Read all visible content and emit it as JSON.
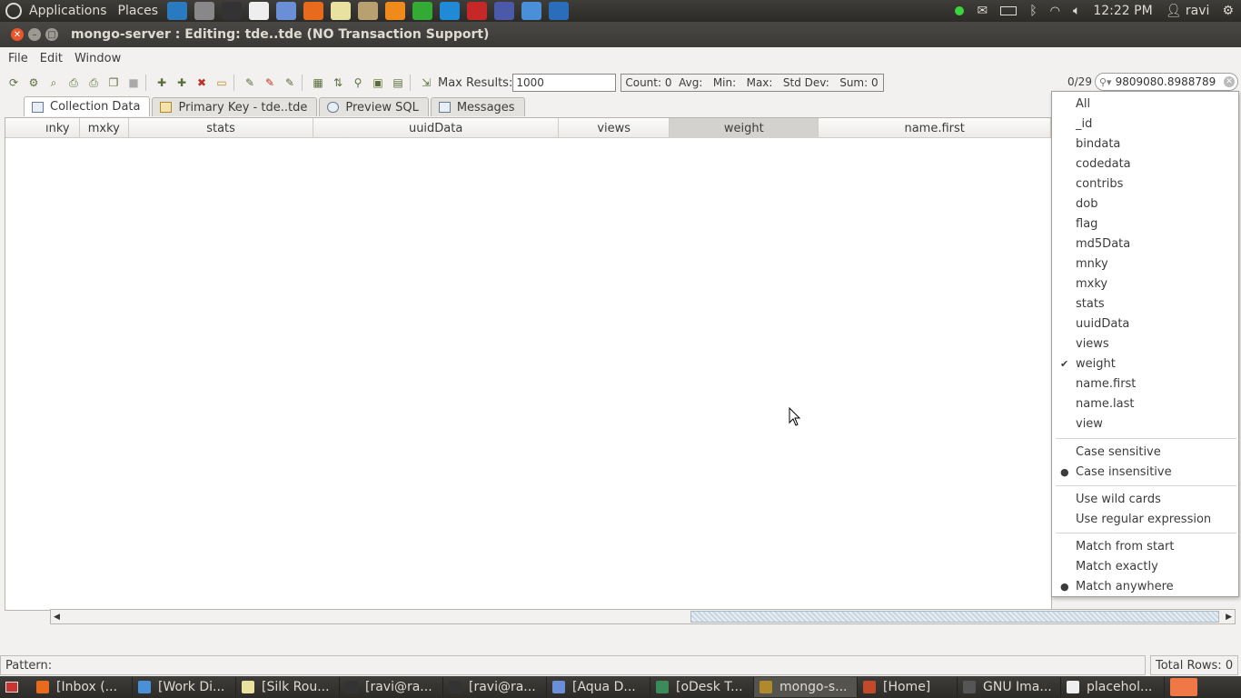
{
  "panel": {
    "applications": "Applications",
    "places": "Places",
    "launchers": [
      "chrome-icon",
      "camera-icon",
      "terminal-icon",
      "text-editor-icon",
      "screenshot-icon",
      "firefox-icon",
      "notes-icon",
      "file-manager-icon",
      "vlc-icon",
      "system-monitor-icon",
      "teamviewer-icon",
      "filezilla-icon",
      "eclipse-icon",
      "chromium-icon",
      "thunderbird-icon"
    ],
    "time": "12:22 PM",
    "user": "ravi"
  },
  "window": {
    "title": "mongo-server : Editing: tde..tde (NO Transaction Support)"
  },
  "menu": {
    "file": "File",
    "edit": "Edit",
    "window": "Window"
  },
  "toolbar": {
    "max_results_label": "Max Results:",
    "max_results_value": "1000",
    "stats": "Count: 0  Avg:   Min:   Max:   Std Dev:   Sum: 0",
    "match_count": "0/29",
    "search_value": "9809080.8988789"
  },
  "tabs": [
    "Collection Data",
    "Primary Key - tde..tde",
    "Preview SQL",
    "Messages"
  ],
  "columns": [
    "ınky",
    "mxky",
    "stats",
    "uuidData",
    "views",
    "weight",
    "name.first"
  ],
  "selected_column": "weight",
  "dropdown": {
    "columns": [
      "All",
      "_id",
      "bindata",
      "codedata",
      "contribs",
      "dob",
      "flag",
      "md5Data",
      "mnky",
      "mxky",
      "stats",
      "uuidData",
      "views",
      "weight",
      "name.first",
      "name.last",
      "view"
    ],
    "checked": "weight",
    "case_options": [
      "Case sensitive",
      "Case insensitive"
    ],
    "case_selected": "Case insensitive",
    "pattern_options": [
      "Use wild cards",
      "Use regular expression"
    ],
    "match_options": [
      "Match from start",
      "Match exactly",
      "Match anywhere"
    ],
    "match_selected": "Match anywhere"
  },
  "status": {
    "pattern_label": "Pattern:",
    "total_rows": "Total Rows: 0"
  },
  "taskbar": [
    "[Inbox (...",
    "[Work Di...",
    "[Silk Rou...",
    "[ravi@ra...",
    "[ravi@ra...",
    "[Aqua D...",
    "[oDesk T...",
    "mongo-s...",
    "[Home]",
    "GNU Ima...",
    "placehol..."
  ],
  "taskbar_active": "mongo-s...",
  "colors": {
    "panel": "#3c3b37",
    "selection_header": "#d4d2cf",
    "accent": "#dd4814"
  }
}
